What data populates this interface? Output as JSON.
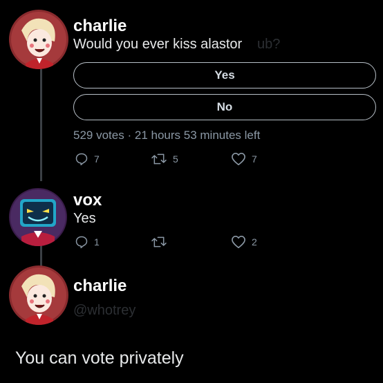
{
  "tweet1": {
    "name": "charlie",
    "text": "Would you ever kiss alastor",
    "ghost_text": "ub?",
    "poll": {
      "options": [
        "Yes",
        "No"
      ],
      "votes": "529 votes",
      "separator": "·",
      "time_left": "21 hours 53 minutes left"
    },
    "actions": {
      "replies": "7",
      "retweets": "5",
      "likes": "7"
    }
  },
  "tweet2": {
    "name": "vox",
    "text": "Yes",
    "actions": {
      "replies": "1",
      "retweets": "",
      "likes": "2"
    }
  },
  "tweet3": {
    "name": "charlie",
    "handle": "@whotrey"
  },
  "caption": "You can vote privately",
  "colors": {
    "background": "#000000",
    "text": "#e7e9ea",
    "muted": "#8b98a5",
    "poll_border": "#b8c0c8",
    "thread_line": "#3a3f44"
  },
  "icons": [
    "reply-icon",
    "retweet-icon",
    "like-icon"
  ]
}
